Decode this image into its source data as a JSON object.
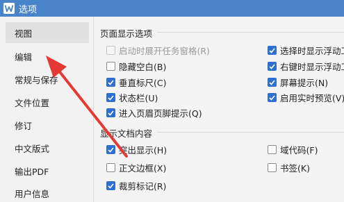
{
  "window": {
    "title": "选项"
  },
  "sidebar": {
    "items": [
      {
        "label": "视图",
        "active": true
      },
      {
        "label": "编辑",
        "active": false
      },
      {
        "label": "常规与保存",
        "active": false
      },
      {
        "label": "文件位置",
        "active": false
      },
      {
        "label": "修订",
        "active": false
      },
      {
        "label": "中文版式",
        "active": false
      },
      {
        "label": "输出PDF",
        "active": false
      },
      {
        "label": "用户信息",
        "active": false
      }
    ]
  },
  "page_display": {
    "title": "页面显示选项",
    "left": [
      {
        "label": "启动时展开任务窗格(R)",
        "checked": false,
        "disabled": true
      },
      {
        "label": "隐藏空白(B)",
        "checked": false,
        "disabled": false
      },
      {
        "label": "垂直标尺(C)",
        "checked": true,
        "disabled": false
      },
      {
        "label": "状态栏(U)",
        "checked": true,
        "disabled": false
      },
      {
        "label": "进入页眉页脚提示(Q)",
        "checked": true,
        "disabled": false
      }
    ],
    "right": [
      {
        "label": "选择时显示浮动工",
        "checked": true,
        "disabled": false
      },
      {
        "label": "右键时显示浮动工",
        "checked": true,
        "disabled": false
      },
      {
        "label": "屏幕提示(N)",
        "checked": true,
        "disabled": false
      },
      {
        "label": "启用实时预览(V)",
        "checked": true,
        "disabled": false
      }
    ]
  },
  "doc_content": {
    "title": "显示文档内容",
    "left": [
      {
        "label": "突出显示(H)",
        "checked": true
      },
      {
        "label": "正文边框(X)",
        "checked": false
      },
      {
        "label": "裁剪标记(R)",
        "checked": true
      }
    ],
    "right": [
      {
        "label": "域代码(F)",
        "checked": false
      },
      {
        "label": "书签(K)",
        "checked": false
      }
    ]
  },
  "colors": {
    "titlebar": "#4a84c8",
    "accent": "#2f6fd1",
    "annotation_arrow": "#e53935"
  },
  "icons": {
    "app": "wps-writer-icon",
    "check": "checkmark-icon",
    "annotation": "red-arrow-pointer"
  }
}
